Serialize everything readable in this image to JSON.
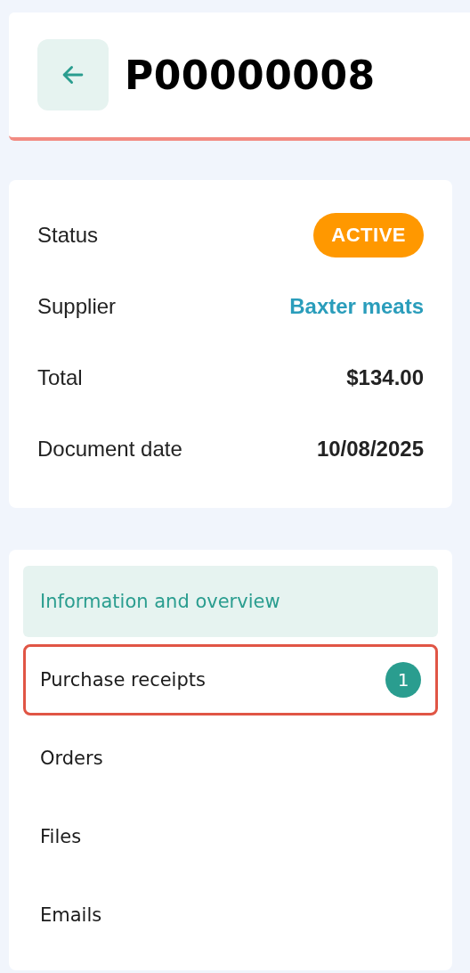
{
  "header": {
    "title": "P00000008"
  },
  "details": [
    {
      "kind": "badge",
      "label": "Status",
      "value": "ACTIVE",
      "color": "#ff9800"
    },
    {
      "kind": "link",
      "label": "Supplier",
      "value": "Baxter meats"
    },
    {
      "kind": "text",
      "label": "Total",
      "value": "$134.00"
    },
    {
      "kind": "text",
      "label": "Document date",
      "value": "10/08/2025"
    }
  ],
  "nav": [
    {
      "label": "Information and overview",
      "selected": true,
      "focused": false
    },
    {
      "label": "Purchase receipts",
      "selected": false,
      "focused": true,
      "count": "1"
    },
    {
      "label": "Orders",
      "selected": false,
      "focused": false
    },
    {
      "label": "Files",
      "selected": false,
      "focused": false
    },
    {
      "label": "Emails",
      "selected": false,
      "focused": false
    }
  ]
}
